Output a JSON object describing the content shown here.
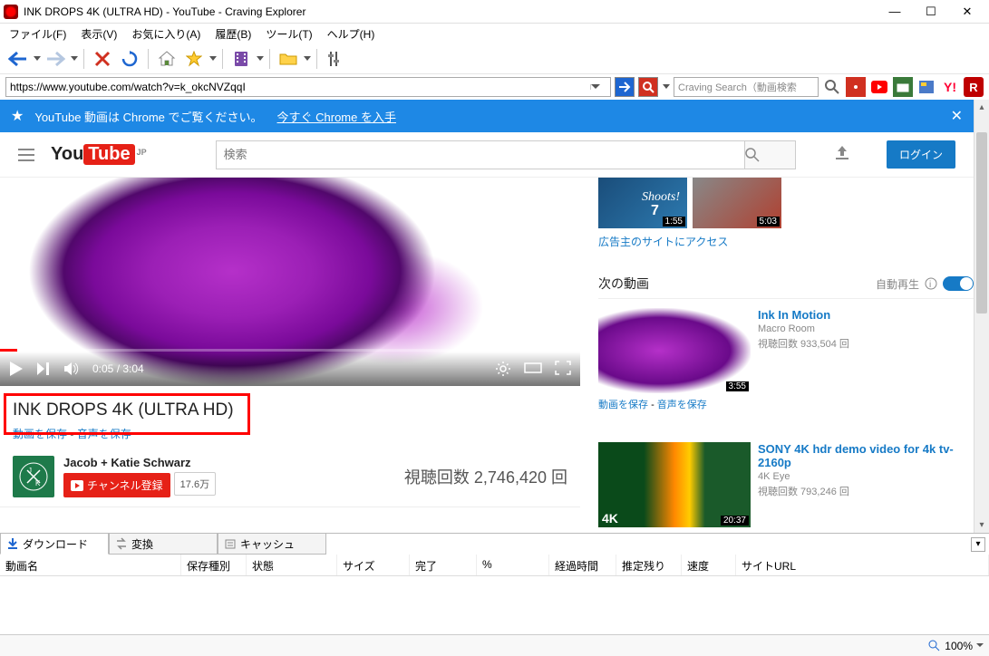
{
  "window": {
    "title": "INK DROPS 4K (ULTRA HD) - YouTube - Craving Explorer"
  },
  "menu": {
    "file": "ファイル(F)",
    "view": "表示(V)",
    "favorites": "お気に入り(A)",
    "history": "履歴(B)",
    "tools": "ツール(T)",
    "help": "ヘルプ(H)"
  },
  "address": {
    "url": "https://www.youtube.com/watch?v=k_okcNVZqqI",
    "search_placeholder": "Craving Search（動画検索"
  },
  "banner": {
    "text": "YouTube 動画は Chrome でご覧ください。",
    "link": "今すぐ Chrome を入手"
  },
  "yt": {
    "logo_country": "JP",
    "search_placeholder": "検索",
    "login": "ログイン",
    "player": {
      "time": "0:05 / 3:04"
    },
    "video": {
      "title": "INK DROPS 4K (ULTRA HD)",
      "save_video": "動画を保存",
      "save_audio": "音声を保存",
      "channel": "Jacob + Katie Schwarz",
      "subscribe": "チャンネル登録",
      "sub_count": "17.6万",
      "views": "視聴回数 2,746,420 回"
    },
    "ads": {
      "dur1": "1:55",
      "dur2": "5:03",
      "shoot": "Shoots!",
      "num": "7",
      "link": "広告主のサイトにアクセス"
    },
    "next": {
      "label": "次の動画",
      "autoplay": "自動再生"
    },
    "related": [
      {
        "title": "Ink In Motion",
        "channel": "Macro Room",
        "views": "視聴回数 933,504 回",
        "dur": "3:55",
        "save_v": "動画を保存",
        "save_a": "音声を保存"
      },
      {
        "title": "SONY 4K hdr demo video for 4k tv-2160p",
        "channel": "4K Eye",
        "views": "視聴回数 793,246 回",
        "dur": "20:37"
      }
    ]
  },
  "dl": {
    "tabs": {
      "download": "ダウンロード",
      "convert": "変換",
      "cache": "キャッシュ"
    },
    "cols": {
      "name": "動画名",
      "type": "保存種別",
      "status": "状態",
      "size": "サイズ",
      "done": "完了",
      "pct": "%",
      "elapsed": "経過時間",
      "remain": "推定残り",
      "speed": "速度",
      "url": "サイトURL"
    }
  },
  "status": {
    "zoom": "100%"
  }
}
